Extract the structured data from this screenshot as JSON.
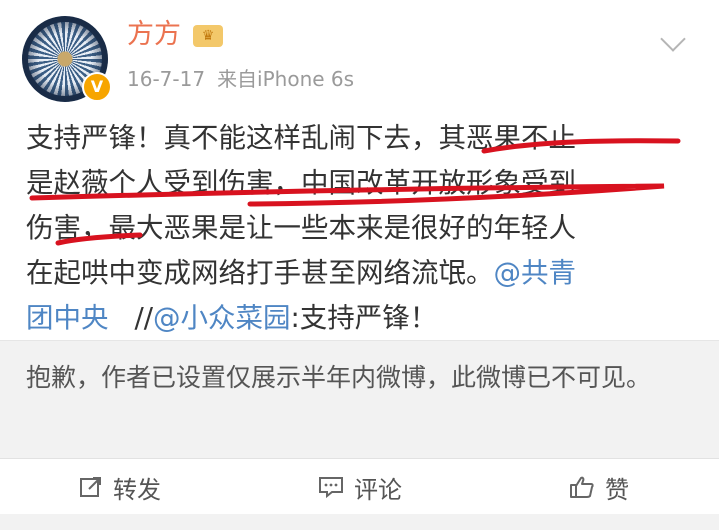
{
  "post": {
    "author": "方方",
    "date": "16-7-17",
    "source": "来自iPhone 6s",
    "lines": [
      "支持严锋！真不能这样乱闹下去，其恶果不止",
      "是赵薇个人受到伤害，中国改革开放形象受到",
      "伤害，最大恶果是让一些本来是很好的年轻人"
    ],
    "line4_text": "在起哄中变成网络打手甚至网络流氓。",
    "line4_mention": "@共青",
    "line5_mention1": "团中央",
    "line5_sep": "//",
    "line5_mention2": "@小众菜园",
    "line5_text": ":支持严锋！"
  },
  "notice": {
    "text": "抱歉，作者已设置仅展示半年内微博，此微博已不可见。"
  },
  "actions": {
    "repost": "转发",
    "comment": "评论",
    "like": "赞"
  },
  "colors": {
    "author": "#eb7350",
    "mention": "#4f86c4",
    "annotation": "#d8121f",
    "badge": "#f7a500"
  }
}
